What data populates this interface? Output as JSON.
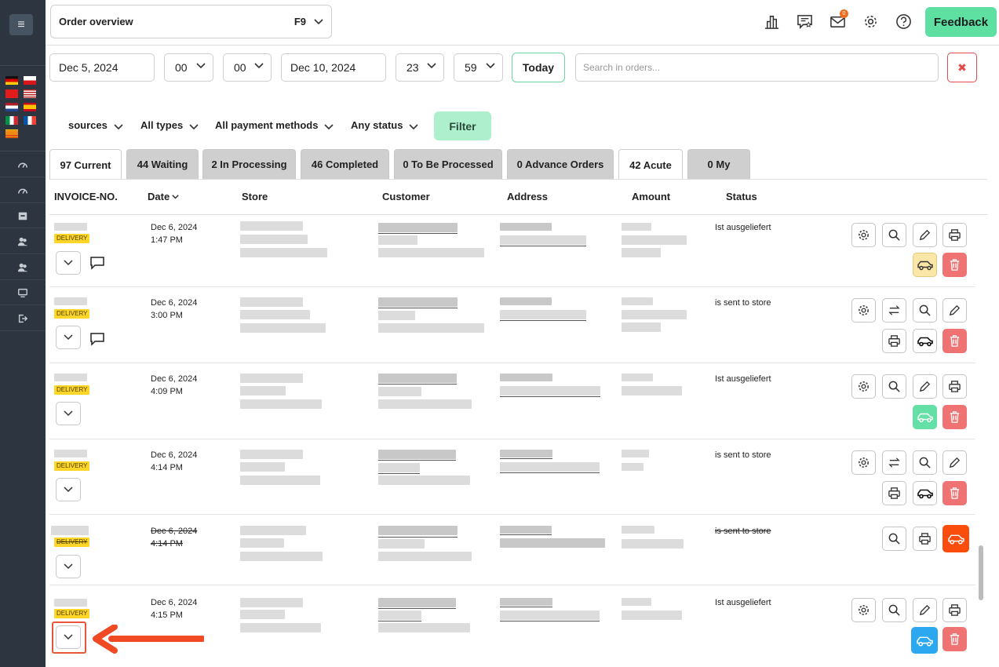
{
  "topbar": {
    "order_select_label": "Order overview",
    "order_select_key": "F9",
    "mail_badge": "0",
    "feedback_label": "Feedback",
    "icons": [
      "bar-chart-icon",
      "rating-comment-icon",
      "mail-icon",
      "gear-icon",
      "help-icon"
    ]
  },
  "date_range": {
    "from_date": "Dec 5, 2024",
    "from_hour": "00",
    "from_minute": "00",
    "to_date": "Dec 10, 2024",
    "to_hour": "23",
    "to_minute": "59",
    "today_label": "Today",
    "search_placeholder": "Search in orders...",
    "clear_label": "✖"
  },
  "filters": {
    "sources": "sources",
    "types": "All types",
    "payment": "All payment methods",
    "status": "Any status",
    "filter_label": "Filter"
  },
  "tabs": [
    {
      "label": "97 Current",
      "active": true
    },
    {
      "label": "44 Waiting",
      "active": false
    },
    {
      "label": "2 In Processing",
      "active": false
    },
    {
      "label": "46 Completed",
      "active": false
    },
    {
      "label": "0 To Be Processed",
      "active": false
    },
    {
      "label": "0 Advance Orders",
      "active": false
    },
    {
      "label": "42 Acute",
      "active": true
    },
    {
      "label": "0 My",
      "active": false
    }
  ],
  "table": {
    "columns": [
      "INVOICE-NO.",
      "Date",
      "Store",
      "Customer",
      "Address",
      "Amount",
      "Status"
    ],
    "rows": [
      {
        "tag": "DELIVERY",
        "date": "Dec 6, 2024",
        "time": "1:47 PM",
        "status": "Ist ausgeliefert",
        "car_color": "yellow"
      },
      {
        "tag": "DELIVERY",
        "date": "Dec 6, 2024",
        "time": "3:00 PM",
        "status": "is sent to store",
        "car_color": "white"
      },
      {
        "tag": "DELIVERY",
        "date": "Dec 6, 2024",
        "time": "4:09 PM",
        "status": "Ist ausgeliefert",
        "car_color": "green"
      },
      {
        "tag": "DELIVERY",
        "date": "Dec 6, 2024",
        "time": "4:14 PM",
        "status": "is sent to store",
        "car_color": "white"
      },
      {
        "tag": "DELIVERY",
        "date": "Dec 6, 2024",
        "time": "4:14 PM",
        "status": "is sent to store",
        "car_color": "orange",
        "cancelled": true
      },
      {
        "tag": "DELIVERY",
        "date": "Dec 6, 2024",
        "time": "4:15 PM",
        "status": "Ist ausgeliefert",
        "car_color": "blue"
      }
    ]
  },
  "sidebar": {
    "menu_icon": "hamburger-icon",
    "flags": [
      "de",
      "cz",
      "ch",
      "us",
      "nl",
      "es",
      "it",
      "fr",
      "ca"
    ],
    "nav_icons": [
      "dashboard-icon",
      "dashboard-icon",
      "store-icon",
      "users-icon",
      "users-icon",
      "monitor-icon",
      "logout-icon"
    ]
  }
}
